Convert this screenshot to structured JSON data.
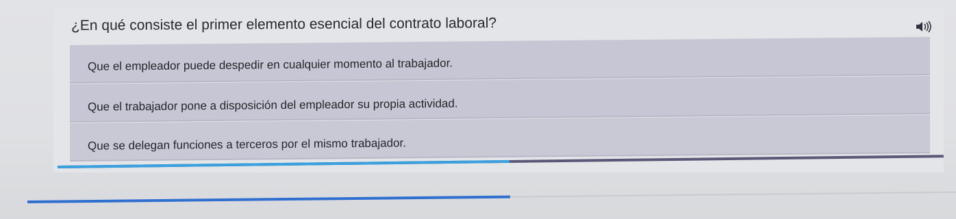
{
  "question": {
    "text": "¿En qué consiste el primer elemento esencial del contrato laboral?",
    "audio_icon": "speaker-icon"
  },
  "options": [
    {
      "label": "Que el empleador puede despedir en cualquier momento al trabajador."
    },
    {
      "label": "Que el trabajador pone a disposición del empleador su propia actividad."
    },
    {
      "label": "Que se delegan funciones a terceros por el mismo trabajador."
    }
  ],
  "progress": {
    "fraction": 0.51,
    "fill_color": "#3aa0e0",
    "track_color": "#5a5878"
  },
  "secondary_progress": {
    "fraction": 0.52,
    "fill_color": "#2f6fd0"
  },
  "colors": {
    "background": "#e2e3e6",
    "option_bg": "#c6c6d4",
    "text": "#26262c"
  }
}
